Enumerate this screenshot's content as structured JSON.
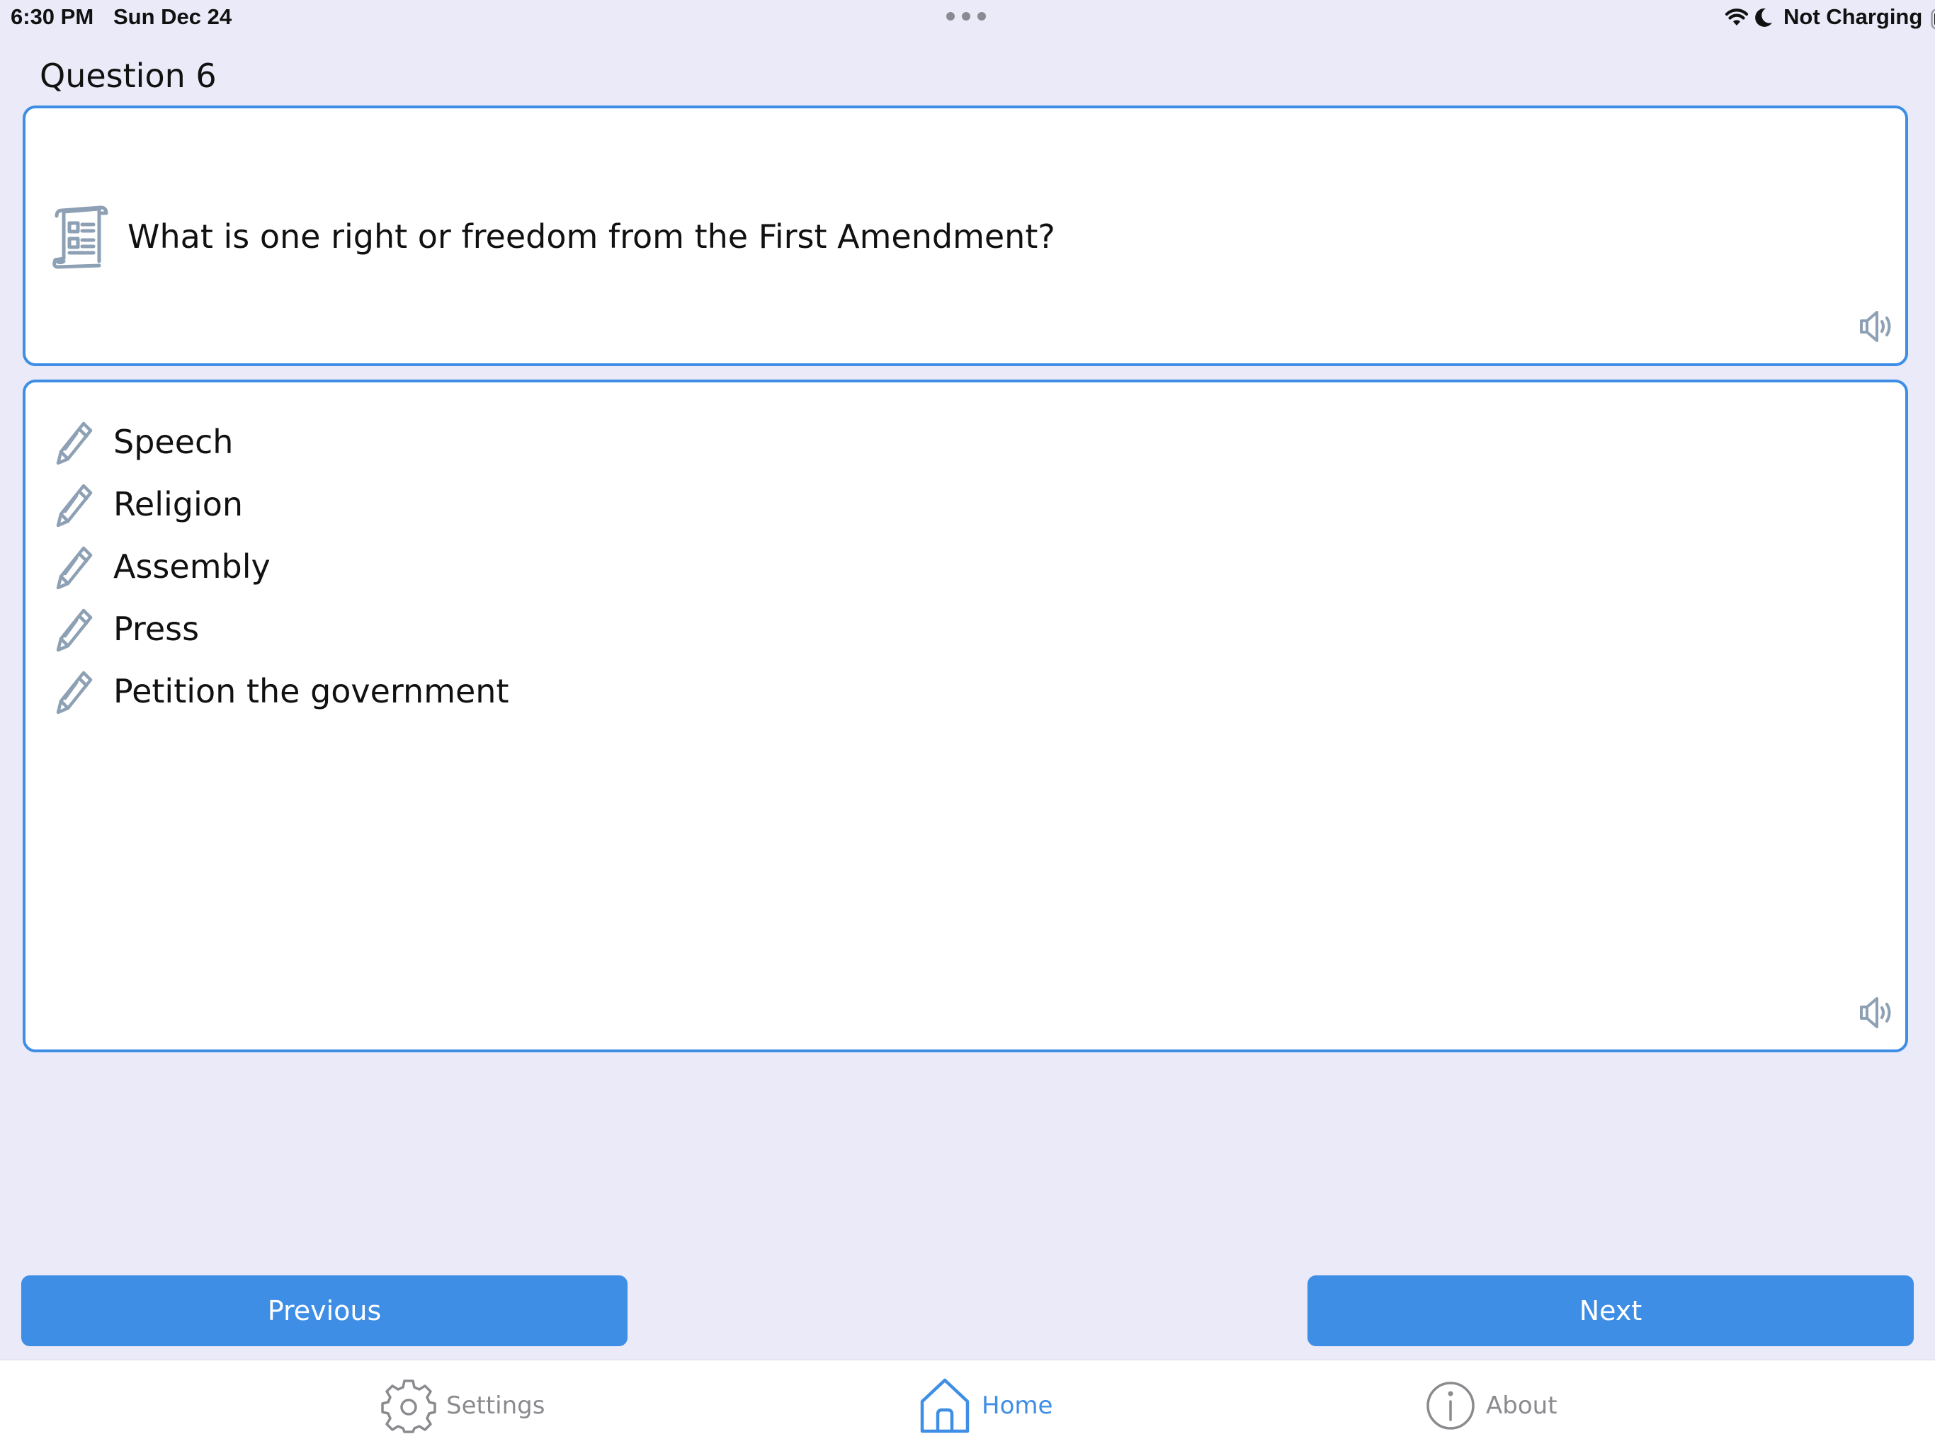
{
  "status_bar": {
    "time": "6:30 PM",
    "date": "Sun Dec 24",
    "charging": "Not Charging",
    "icons": [
      "wifi-icon",
      "moon-icon",
      "battery-icon"
    ]
  },
  "question": {
    "title": "Question 6",
    "text": "What is one right or freedom from the First Amendment?",
    "icon": "scroll-icon"
  },
  "answers": {
    "icon": "pencil-icon",
    "items": [
      "Speech",
      "Religion",
      "Assembly",
      "Press",
      "Petition the government"
    ]
  },
  "buttons": {
    "previous": "Previous",
    "next": "Next"
  },
  "tabs": {
    "settings": "Settings",
    "home": "Home",
    "about": "About",
    "active": "Home"
  },
  "colors": {
    "accent": "#3E8EE6",
    "background": "#EAEAF8",
    "icon_gray": "#8DA0B4"
  }
}
